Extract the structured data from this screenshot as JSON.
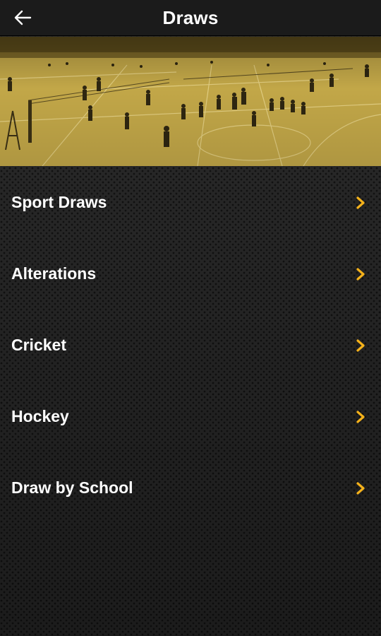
{
  "header": {
    "title": "Draws",
    "back_icon": "arrow-left-icon"
  },
  "hero": {
    "image": "sports-hall-volleyball-photo",
    "tint": "#c5a94a"
  },
  "menu": {
    "items": [
      {
        "label": "Sport Draws",
        "icon": "chevron-right-icon"
      },
      {
        "label": "Alterations",
        "icon": "chevron-right-icon"
      },
      {
        "label": "Cricket",
        "icon": "chevron-right-icon"
      },
      {
        "label": "Hockey",
        "icon": "chevron-right-icon"
      },
      {
        "label": "Draw by School",
        "icon": "chevron-right-icon"
      }
    ]
  },
  "colors": {
    "accent": "#f5b21b",
    "header_bg": "#1b1b1b",
    "text": "#ffffff"
  }
}
